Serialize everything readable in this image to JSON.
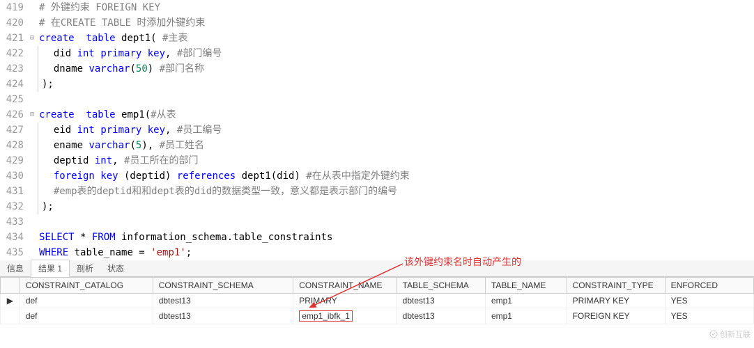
{
  "code": {
    "lines": [
      {
        "n": "419",
        "fold": "",
        "indent": 0,
        "html": "<span class='cmt'># 外键约束 FOREIGN KEY</span>"
      },
      {
        "n": "420",
        "fold": "",
        "indent": 0,
        "html": "<span class='cmt'># 在CREATE TABLE 时添加外键约束</span>"
      },
      {
        "n": "421",
        "fold": "⊟",
        "indent": 0,
        "html": "<span class='kw'>create</span>  <span class='kw'>table</span> dept1( <span class='cmt'>#主表</span>"
      },
      {
        "n": "422",
        "fold": "",
        "indent": 1,
        "html": "  did <span class='kw'>int</span> <span class='kw'>primary key</span>, <span class='cmt'>#部门编号</span>"
      },
      {
        "n": "423",
        "fold": "",
        "indent": 1,
        "html": "  dname <span class='kw'>varchar</span>(<span class='num'>50</span>) <span class='cmt'>#部门名称</span>"
      },
      {
        "n": "424",
        "fold": "",
        "indent": 1,
        "html": ");"
      },
      {
        "n": "425",
        "fold": "",
        "indent": 0,
        "html": ""
      },
      {
        "n": "426",
        "fold": "⊟",
        "indent": 0,
        "html": "<span class='kw'>create</span>  <span class='kw'>table</span> emp1(<span class='cmt'>#从表</span>"
      },
      {
        "n": "427",
        "fold": "",
        "indent": 1,
        "html": "  eid <span class='kw'>int</span> <span class='kw'>primary key</span>, <span class='cmt'>#员工编号</span>"
      },
      {
        "n": "428",
        "fold": "",
        "indent": 1,
        "html": "  ename <span class='kw'>varchar</span>(<span class='num'>5</span>), <span class='cmt'>#员工姓名</span>"
      },
      {
        "n": "429",
        "fold": "",
        "indent": 1,
        "html": "  deptid <span class='kw'>int</span>, <span class='cmt'>#员工所在的部门</span>"
      },
      {
        "n": "430",
        "fold": "",
        "indent": 1,
        "html": "  <span class='kw'>foreign key</span> (deptid) <span class='kw'>references</span> dept1(did) <span class='cmt'>#在从表中指定外键约束</span>"
      },
      {
        "n": "431",
        "fold": "",
        "indent": 1,
        "html": "  <span class='cmt'>#emp表的deptid和和dept表的did的数据类型一致，意义都是表示部门的编号</span>"
      },
      {
        "n": "432",
        "fold": "",
        "indent": 1,
        "html": ");"
      },
      {
        "n": "433",
        "fold": "",
        "indent": 0,
        "html": ""
      },
      {
        "n": "434",
        "fold": "",
        "indent": 0,
        "html": "<span class='kw'>SELECT</span> * <span class='kw'>FROM</span> information_schema.table_constraints"
      },
      {
        "n": "435",
        "fold": "",
        "indent": 0,
        "html": "<span class='kw'>WHERE</span> table_name = <span class='str'>'emp1'</span>;"
      }
    ]
  },
  "tabs": [
    {
      "label": "信息",
      "active": false
    },
    {
      "label": "结果 1",
      "active": true
    },
    {
      "label": "剖析",
      "active": false
    },
    {
      "label": "状态",
      "active": false
    }
  ],
  "annotation": "该外键约束名时自动产生的",
  "table": {
    "headers": [
      "CONSTRAINT_CATALOG",
      "CONSTRAINT_SCHEMA",
      "CONSTRAINT_NAME",
      "TABLE_SCHEMA",
      "TABLE_NAME",
      "CONSTRAINT_TYPE",
      "ENFORCED"
    ],
    "rows": [
      {
        "marker": "▶",
        "cells": [
          "def",
          "dbtest13",
          "PRIMARY",
          "dbtest13",
          "emp1",
          "PRIMARY KEY",
          "YES"
        ],
        "highlight": false
      },
      {
        "marker": "",
        "cells": [
          "def",
          "dbtest13",
          "emp1_ibfk_1",
          "dbtest13",
          "emp1",
          "FOREIGN KEY",
          "YES"
        ],
        "highlight": true
      }
    ]
  },
  "watermark": "创新互联"
}
